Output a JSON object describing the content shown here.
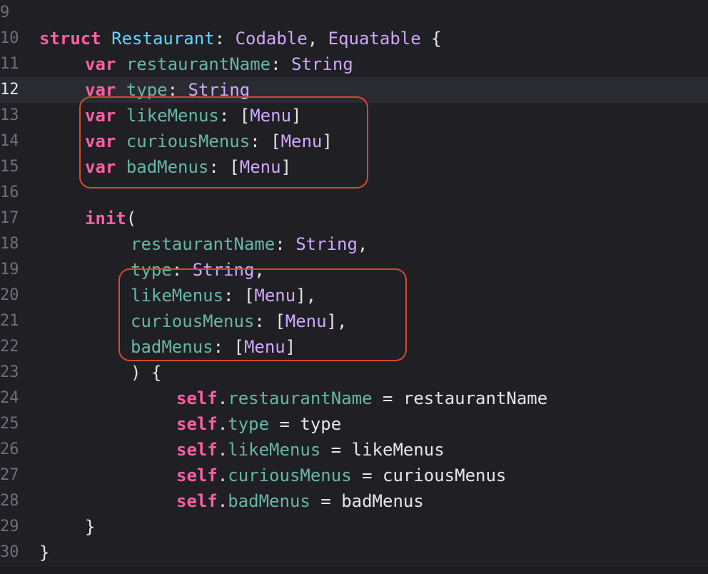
{
  "editor": {
    "current_line": 12,
    "lines": [
      {
        "n": "9",
        "tokens": []
      },
      {
        "n": "10",
        "tokens": [
          [
            "kw",
            "struct"
          ],
          [
            "plain",
            " "
          ],
          [
            "tname",
            "Restaurant"
          ],
          [
            "plain",
            ": "
          ],
          [
            "proto",
            "Codable"
          ],
          [
            "plain",
            ", "
          ],
          [
            "proto",
            "Equatable"
          ],
          [
            "plain",
            " {"
          ]
        ]
      },
      {
        "n": "11",
        "tokens": [
          [
            "kw",
            "var"
          ],
          [
            "plain",
            " "
          ],
          [
            "prop",
            "restaurantName"
          ],
          [
            "plain",
            ": "
          ],
          [
            "proto",
            "String"
          ]
        ]
      },
      {
        "n": "12",
        "tokens": [
          [
            "kw",
            "var"
          ],
          [
            "plain",
            " "
          ],
          [
            "prop",
            "type"
          ],
          [
            "plain",
            ": "
          ],
          [
            "proto",
            "String"
          ]
        ]
      },
      {
        "n": "13",
        "tokens": [
          [
            "kw",
            "var"
          ],
          [
            "plain",
            " "
          ],
          [
            "prop",
            "likeMenus"
          ],
          [
            "plain",
            ": ["
          ],
          [
            "menu-t",
            "Menu"
          ],
          [
            "plain",
            "]"
          ]
        ]
      },
      {
        "n": "14",
        "tokens": [
          [
            "kw",
            "var"
          ],
          [
            "plain",
            " "
          ],
          [
            "prop",
            "curiousMenus"
          ],
          [
            "plain",
            ": ["
          ],
          [
            "menu-t",
            "Menu"
          ],
          [
            "plain",
            "]"
          ]
        ]
      },
      {
        "n": "15",
        "tokens": [
          [
            "kw",
            "var"
          ],
          [
            "plain",
            " "
          ],
          [
            "prop",
            "badMenus"
          ],
          [
            "plain",
            ": ["
          ],
          [
            "menu-t",
            "Menu"
          ],
          [
            "plain",
            "]"
          ]
        ]
      },
      {
        "n": "16",
        "tokens": []
      },
      {
        "n": "17",
        "tokens": [
          [
            "kw",
            "init"
          ],
          [
            "plain",
            "("
          ]
        ]
      },
      {
        "n": "18",
        "tokens": [
          [
            "prop",
            "restaurantName"
          ],
          [
            "plain",
            ": "
          ],
          [
            "proto",
            "String"
          ],
          [
            "plain",
            ","
          ]
        ]
      },
      {
        "n": "19",
        "tokens": [
          [
            "prop",
            "type"
          ],
          [
            "plain",
            ": "
          ],
          [
            "proto",
            "String"
          ],
          [
            "plain",
            ","
          ]
        ]
      },
      {
        "n": "20",
        "tokens": [
          [
            "prop",
            "likeMenus"
          ],
          [
            "plain",
            ": ["
          ],
          [
            "menu-t",
            "Menu"
          ],
          [
            "plain",
            "],"
          ]
        ]
      },
      {
        "n": "21",
        "tokens": [
          [
            "prop",
            "curiousMenus"
          ],
          [
            "plain",
            ": ["
          ],
          [
            "menu-t",
            "Menu"
          ],
          [
            "plain",
            "],"
          ]
        ]
      },
      {
        "n": "22",
        "tokens": [
          [
            "prop",
            "badMenus"
          ],
          [
            "plain",
            ": ["
          ],
          [
            "menu-t",
            "Menu"
          ],
          [
            "plain",
            "]"
          ]
        ]
      },
      {
        "n": "23",
        "tokens": [
          [
            "plain",
            ") {"
          ]
        ]
      },
      {
        "n": "24",
        "tokens": [
          [
            "kw",
            "self"
          ],
          [
            "plain",
            "."
          ],
          [
            "prop",
            "restaurantName"
          ],
          [
            "plain",
            " = restaurantName"
          ]
        ]
      },
      {
        "n": "25",
        "tokens": [
          [
            "kw",
            "self"
          ],
          [
            "plain",
            "."
          ],
          [
            "prop",
            "type"
          ],
          [
            "plain",
            " = type"
          ]
        ]
      },
      {
        "n": "26",
        "tokens": [
          [
            "kw",
            "self"
          ],
          [
            "plain",
            "."
          ],
          [
            "prop",
            "likeMenus"
          ],
          [
            "plain",
            " = likeMenus"
          ]
        ]
      },
      {
        "n": "27",
        "tokens": [
          [
            "kw",
            "self"
          ],
          [
            "plain",
            "."
          ],
          [
            "prop",
            "curiousMenus"
          ],
          [
            "plain",
            " = curiousMenus"
          ]
        ]
      },
      {
        "n": "28",
        "tokens": [
          [
            "kw",
            "self"
          ],
          [
            "plain",
            "."
          ],
          [
            "prop",
            "badMenus"
          ],
          [
            "plain",
            " = badMenus"
          ]
        ]
      },
      {
        "n": "29",
        "tokens": [
          [
            "plain",
            "}"
          ]
        ]
      },
      {
        "n": "30",
        "tokens": [
          [
            "plain",
            "}"
          ]
        ]
      }
    ]
  },
  "colors": {
    "background": "#1f1f24",
    "keyword": "#fc5fa3",
    "type_name": "#5dd8ff",
    "protocol": "#d0a8ff",
    "property": "#67b7a4",
    "plain": "#e6e6e8",
    "annotation": "#d9482b"
  }
}
